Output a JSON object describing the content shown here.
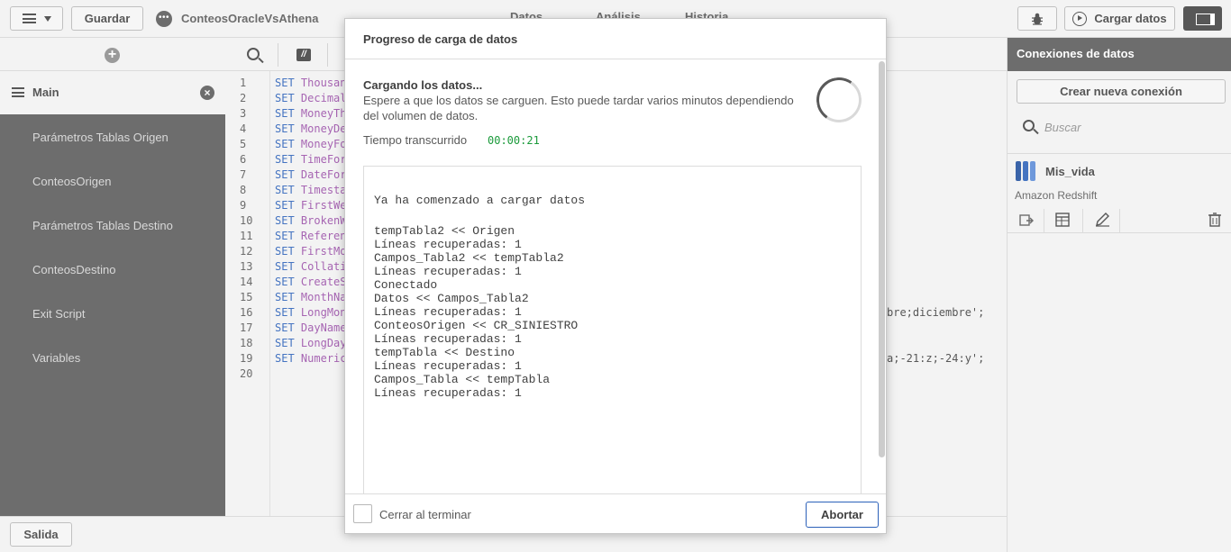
{
  "toolbar": {
    "save_label": "Guardar",
    "app_name": "ConteosOracleVsAthena",
    "tabs": [
      "Datos",
      "Análisis",
      "Historia"
    ],
    "load_data_label": "Cargar datos"
  },
  "sidebar": {
    "main_label": "Main",
    "items": [
      "Parámetros Tablas Origen",
      "ConteosOrigen",
      "Parámetros Tablas Destino",
      "ConteosDestino",
      "Exit Script",
      "Variables"
    ]
  },
  "editor": {
    "line_numbers": [
      "1",
      "2",
      "3",
      "4",
      "5",
      "6",
      "7",
      "8",
      "9",
      "10",
      "11",
      "12",
      "13",
      "14",
      "15",
      "16",
      "17",
      "18",
      "19",
      "20"
    ],
    "lines": [
      {
        "kw": "SET",
        "name": "Thousan"
      },
      {
        "kw": "SET",
        "name": "Decimal"
      },
      {
        "kw": "SET",
        "name": "MoneyTh"
      },
      {
        "kw": "SET",
        "name": "MoneyDe"
      },
      {
        "kw": "SET",
        "name": "MoneyFo"
      },
      {
        "kw": "SET",
        "name": "TimeFor"
      },
      {
        "kw": "SET",
        "name": "DateFor"
      },
      {
        "kw": "SET",
        "name": "Timesta"
      },
      {
        "kw": "SET",
        "name": "FirstWe"
      },
      {
        "kw": "SET",
        "name": "BrokenW"
      },
      {
        "kw": "SET",
        "name": "Referen"
      },
      {
        "kw": "SET",
        "name": "FirstMo"
      },
      {
        "kw": "SET",
        "name": "Collati"
      },
      {
        "kw": "SET",
        "name": "CreateS"
      },
      {
        "kw": "SET",
        "name": "MonthNa"
      },
      {
        "kw": "SET",
        "name": "LongMon"
      },
      {
        "kw": "SET",
        "name": "DayName"
      },
      {
        "kw": "SET",
        "name": "LongDay"
      },
      {
        "kw": "SET",
        "name": "Numeric"
      }
    ],
    "line16_tail": "bre;diciembre';",
    "line19_tail": "a;-21:z;-24:y';"
  },
  "connections": {
    "title": "Conexiones de datos",
    "create_label": "Crear nueva conexión",
    "search_placeholder": "Buscar",
    "item_name": "Mis_vida",
    "item_type": "Amazon Redshift"
  },
  "statusbar": {
    "exit_label": "Salida"
  },
  "dialog": {
    "title": "Progreso de carga de datos",
    "status_heading": "Cargando los datos...",
    "status_text": "Espere a que los datos se carguen. Esto puede tardar varios minutos dependiendo del volumen de datos.",
    "elapsed_label": "Tiempo transcurrido",
    "elapsed_value": "00:00:21",
    "log_heading": "Ya ha comenzado a cargar datos",
    "log_lines": [
      "tempTabla2 << Origen",
      "Líneas recuperadas: 1",
      "Campos_Tabla2 << tempTabla2",
      "Líneas recuperadas: 1",
      "Conectado",
      "Datos << Campos_Tabla2",
      "Líneas recuperadas: 1",
      "ConteosOrigen << CR_SINIESTRO",
      "Líneas recuperadas: 1",
      "tempTabla << Destino",
      "Líneas recuperadas: 1",
      "Campos_Tabla << tempTabla",
      "Líneas recuperadas: 1"
    ],
    "close_on_finish_label": "Cerrar al terminar",
    "abort_label": "Abortar"
  },
  "colors": {
    "accent": "#2c61b9",
    "elapsed": "#1a9a3a",
    "sidebar_bg": "#595959"
  }
}
